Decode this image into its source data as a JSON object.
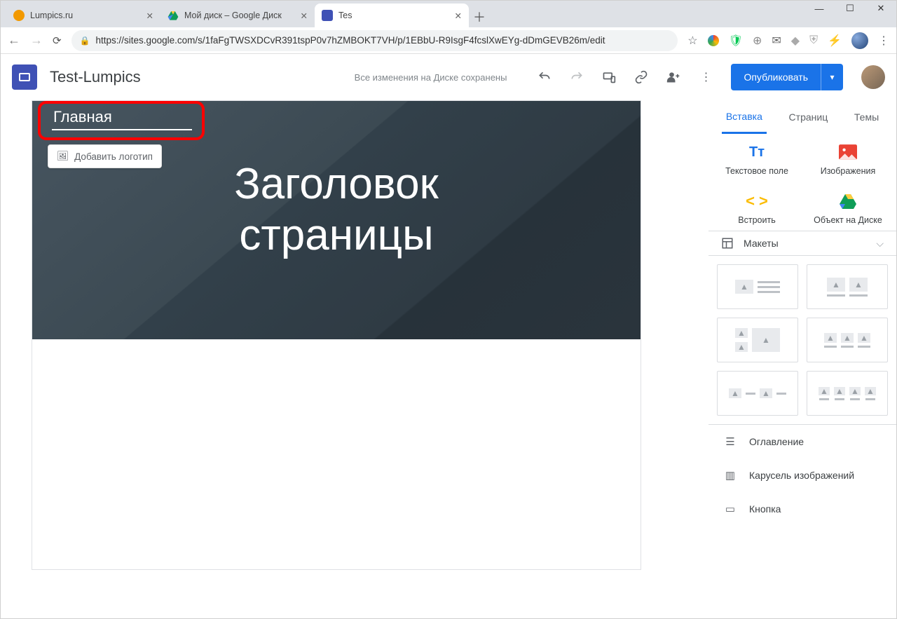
{
  "chrome": {
    "tabs": [
      {
        "title": "Lumpics.ru",
        "fav_color": "#f29900"
      },
      {
        "title": "Мой диск – Google Диск",
        "fav_color": null
      },
      {
        "title": "Tes",
        "active": true
      }
    ],
    "url": "https://sites.google.com/s/1faFgTWSXDCvR391tspP0v7hZMBOKT7VH/p/1EBbU-R9IsgF4fcslXwEYg-dDmGEVB26m/edit"
  },
  "app": {
    "site_name": "Test-Lumpics",
    "saved_status": "Все изменения на Диске сохранены",
    "publish_label": "Опубликовать"
  },
  "canvas": {
    "page_name": "Главная",
    "add_logo_label": "Добавить логотип",
    "hero_title_line1": "Заголовок",
    "hero_title_line2": "страницы"
  },
  "sidebar": {
    "tabs": {
      "insert": "Вставка",
      "pages": "Страниц",
      "themes": "Темы"
    },
    "insert_items": {
      "text_box": "Текстовое поле",
      "images": "Изображения",
      "embed": "Встроить",
      "drive": "Объект на Диске"
    },
    "layouts_label": "Макеты",
    "list": {
      "toc": "Оглавление",
      "carousel": "Карусель изображений",
      "button": "Кнопка"
    }
  }
}
